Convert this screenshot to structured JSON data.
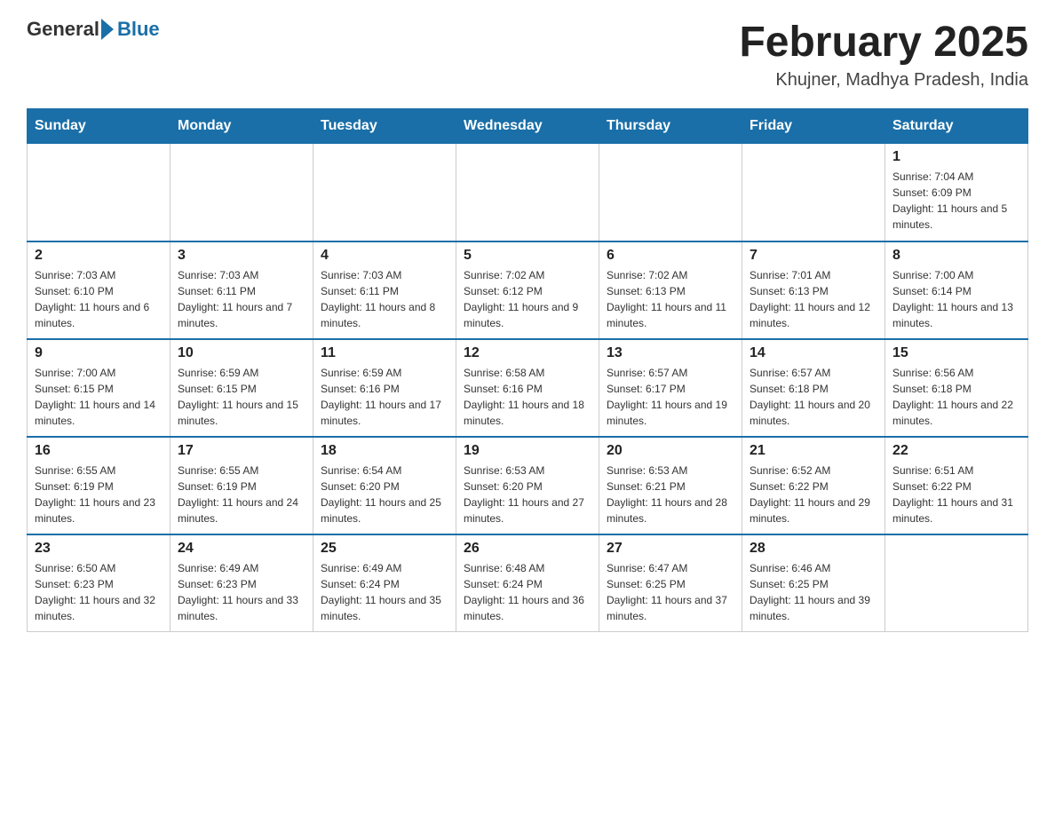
{
  "header": {
    "logo_general": "General",
    "logo_blue": "Blue",
    "title": "February 2025",
    "subtitle": "Khujner, Madhya Pradesh, India"
  },
  "weekdays": [
    "Sunday",
    "Monday",
    "Tuesday",
    "Wednesday",
    "Thursday",
    "Friday",
    "Saturday"
  ],
  "weeks": [
    [
      {
        "day": "",
        "info": ""
      },
      {
        "day": "",
        "info": ""
      },
      {
        "day": "",
        "info": ""
      },
      {
        "day": "",
        "info": ""
      },
      {
        "day": "",
        "info": ""
      },
      {
        "day": "",
        "info": ""
      },
      {
        "day": "1",
        "info": "Sunrise: 7:04 AM\nSunset: 6:09 PM\nDaylight: 11 hours and 5 minutes."
      }
    ],
    [
      {
        "day": "2",
        "info": "Sunrise: 7:03 AM\nSunset: 6:10 PM\nDaylight: 11 hours and 6 minutes."
      },
      {
        "day": "3",
        "info": "Sunrise: 7:03 AM\nSunset: 6:11 PM\nDaylight: 11 hours and 7 minutes."
      },
      {
        "day": "4",
        "info": "Sunrise: 7:03 AM\nSunset: 6:11 PM\nDaylight: 11 hours and 8 minutes."
      },
      {
        "day": "5",
        "info": "Sunrise: 7:02 AM\nSunset: 6:12 PM\nDaylight: 11 hours and 9 minutes."
      },
      {
        "day": "6",
        "info": "Sunrise: 7:02 AM\nSunset: 6:13 PM\nDaylight: 11 hours and 11 minutes."
      },
      {
        "day": "7",
        "info": "Sunrise: 7:01 AM\nSunset: 6:13 PM\nDaylight: 11 hours and 12 minutes."
      },
      {
        "day": "8",
        "info": "Sunrise: 7:00 AM\nSunset: 6:14 PM\nDaylight: 11 hours and 13 minutes."
      }
    ],
    [
      {
        "day": "9",
        "info": "Sunrise: 7:00 AM\nSunset: 6:15 PM\nDaylight: 11 hours and 14 minutes."
      },
      {
        "day": "10",
        "info": "Sunrise: 6:59 AM\nSunset: 6:15 PM\nDaylight: 11 hours and 15 minutes."
      },
      {
        "day": "11",
        "info": "Sunrise: 6:59 AM\nSunset: 6:16 PM\nDaylight: 11 hours and 17 minutes."
      },
      {
        "day": "12",
        "info": "Sunrise: 6:58 AM\nSunset: 6:16 PM\nDaylight: 11 hours and 18 minutes."
      },
      {
        "day": "13",
        "info": "Sunrise: 6:57 AM\nSunset: 6:17 PM\nDaylight: 11 hours and 19 minutes."
      },
      {
        "day": "14",
        "info": "Sunrise: 6:57 AM\nSunset: 6:18 PM\nDaylight: 11 hours and 20 minutes."
      },
      {
        "day": "15",
        "info": "Sunrise: 6:56 AM\nSunset: 6:18 PM\nDaylight: 11 hours and 22 minutes."
      }
    ],
    [
      {
        "day": "16",
        "info": "Sunrise: 6:55 AM\nSunset: 6:19 PM\nDaylight: 11 hours and 23 minutes."
      },
      {
        "day": "17",
        "info": "Sunrise: 6:55 AM\nSunset: 6:19 PM\nDaylight: 11 hours and 24 minutes."
      },
      {
        "day": "18",
        "info": "Sunrise: 6:54 AM\nSunset: 6:20 PM\nDaylight: 11 hours and 25 minutes."
      },
      {
        "day": "19",
        "info": "Sunrise: 6:53 AM\nSunset: 6:20 PM\nDaylight: 11 hours and 27 minutes."
      },
      {
        "day": "20",
        "info": "Sunrise: 6:53 AM\nSunset: 6:21 PM\nDaylight: 11 hours and 28 minutes."
      },
      {
        "day": "21",
        "info": "Sunrise: 6:52 AM\nSunset: 6:22 PM\nDaylight: 11 hours and 29 minutes."
      },
      {
        "day": "22",
        "info": "Sunrise: 6:51 AM\nSunset: 6:22 PM\nDaylight: 11 hours and 31 minutes."
      }
    ],
    [
      {
        "day": "23",
        "info": "Sunrise: 6:50 AM\nSunset: 6:23 PM\nDaylight: 11 hours and 32 minutes."
      },
      {
        "day": "24",
        "info": "Sunrise: 6:49 AM\nSunset: 6:23 PM\nDaylight: 11 hours and 33 minutes."
      },
      {
        "day": "25",
        "info": "Sunrise: 6:49 AM\nSunset: 6:24 PM\nDaylight: 11 hours and 35 minutes."
      },
      {
        "day": "26",
        "info": "Sunrise: 6:48 AM\nSunset: 6:24 PM\nDaylight: 11 hours and 36 minutes."
      },
      {
        "day": "27",
        "info": "Sunrise: 6:47 AM\nSunset: 6:25 PM\nDaylight: 11 hours and 37 minutes."
      },
      {
        "day": "28",
        "info": "Sunrise: 6:46 AM\nSunset: 6:25 PM\nDaylight: 11 hours and 39 minutes."
      },
      {
        "day": "",
        "info": ""
      }
    ]
  ]
}
